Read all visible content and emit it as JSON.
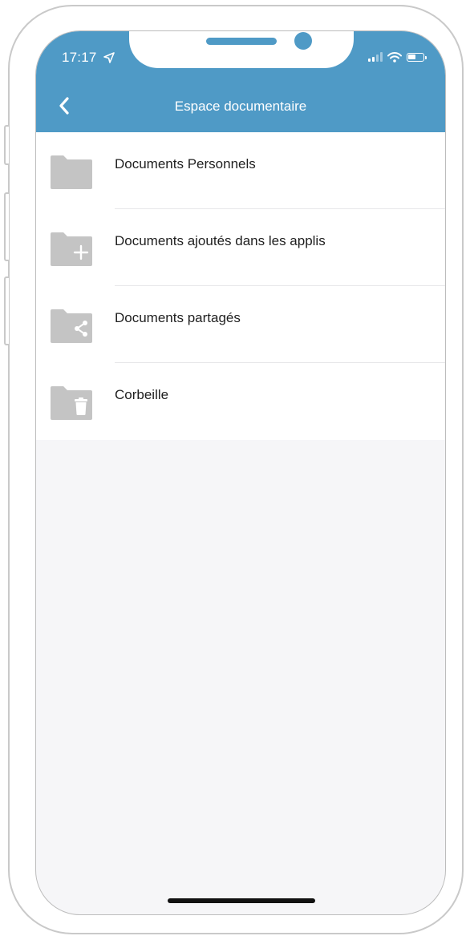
{
  "status_bar": {
    "time": "17:17",
    "location_icon": "location-arrow-icon",
    "signal_icon": "cellular-signal-icon",
    "wifi_icon": "wifi-icon",
    "battery_icon": "battery-icon"
  },
  "nav_bar": {
    "back_icon": "chevron-left-icon",
    "title": "Espace documentaire",
    "background_color": "#4f9ac6"
  },
  "folders": [
    {
      "label": "Documents Personnels",
      "icon": "folder-icon"
    },
    {
      "label": "Documents ajoutés dans les applis",
      "icon": "folder-add-icon"
    },
    {
      "label": "Documents partagés",
      "icon": "folder-share-icon"
    },
    {
      "label": "Corbeille",
      "icon": "folder-trash-icon"
    }
  ],
  "colors": {
    "accent": "#4f9ac6",
    "folder_icon": "#c4c4c4",
    "text": "#1f1f1f",
    "background": "#f6f6f8"
  }
}
